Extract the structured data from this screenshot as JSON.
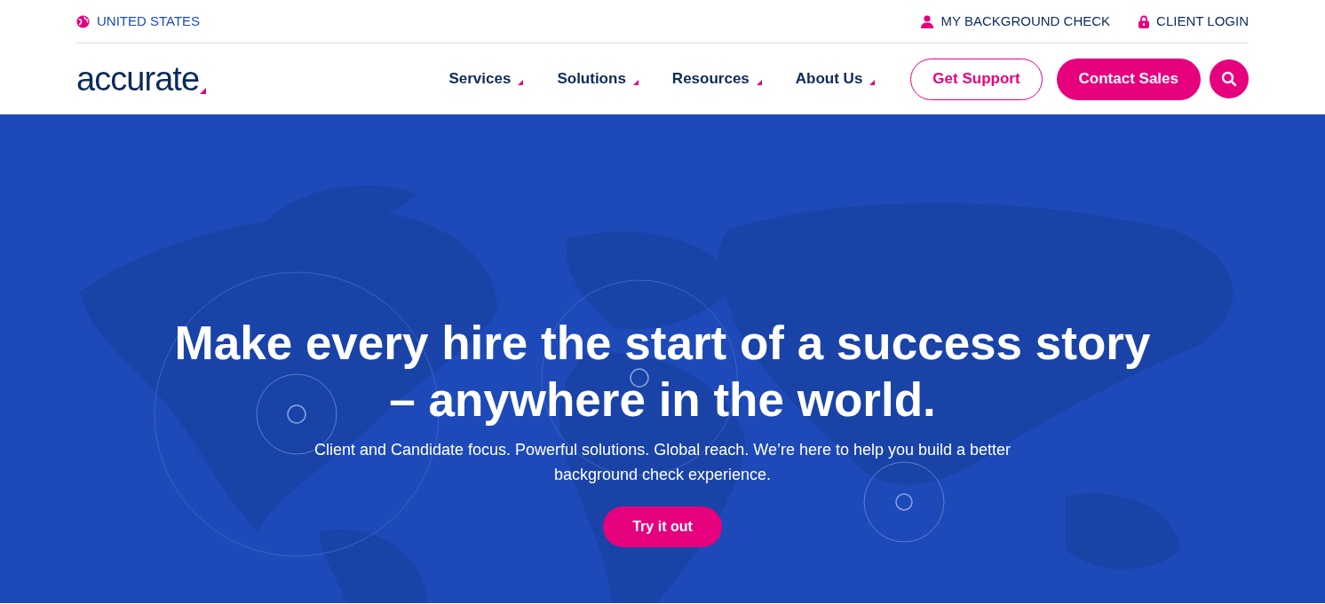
{
  "top_bar": {
    "region": "UNITED STATES",
    "links": [
      "MY BACKGROUND CHECK",
      "CLIENT LOGIN"
    ]
  },
  "logo": {
    "text": "accurate"
  },
  "nav": {
    "items": [
      "Services",
      "Solutions",
      "Resources",
      "About Us"
    ],
    "buttons": [
      {
        "label": "Get Support",
        "kind": "outline"
      },
      {
        "label": "Contact Sales",
        "kind": "filled"
      }
    ]
  },
  "hero": {
    "headline_lines": [
      "Make every hire the start of a success story",
      "– anywhere in the world."
    ],
    "subtitle": "Client and Candidate focus. Powerful solutions. Global reach. We’re here to help you build a better background check experience.",
    "button": "Try it out"
  }
}
